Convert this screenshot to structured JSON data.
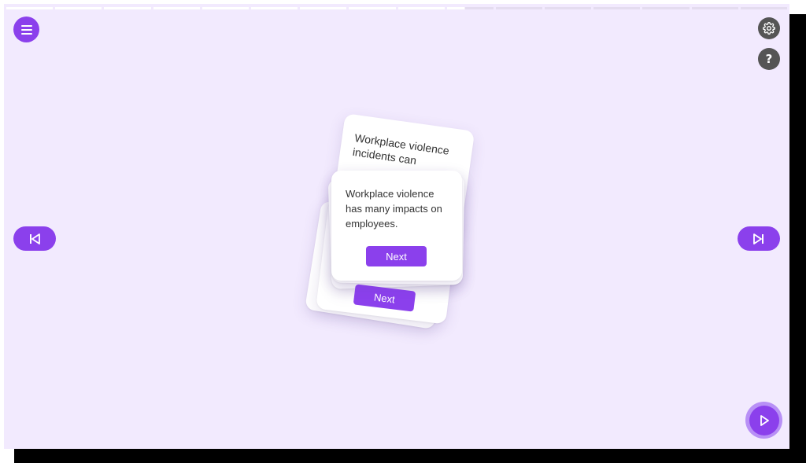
{
  "progress": {
    "segments": 16,
    "completed": 9,
    "partial_fraction": 0.38
  },
  "colors": {
    "accent": "#8b40ec",
    "background": "#f2eafe",
    "icon_gray": "#555555"
  },
  "toolbar": {
    "menu_icon": "hamburger-icon",
    "settings_icon": "gear-icon",
    "help_label": "?"
  },
  "nav": {
    "prev_icon": "skip-back-icon",
    "next_icon": "skip-forward-icon",
    "play_icon": "play-icon"
  },
  "cards": {
    "back_text": "Workplace violence incidents can",
    "back_button": "Next",
    "front_text": "Workplace violence has many impacts on employees.",
    "front_button": "Next"
  }
}
